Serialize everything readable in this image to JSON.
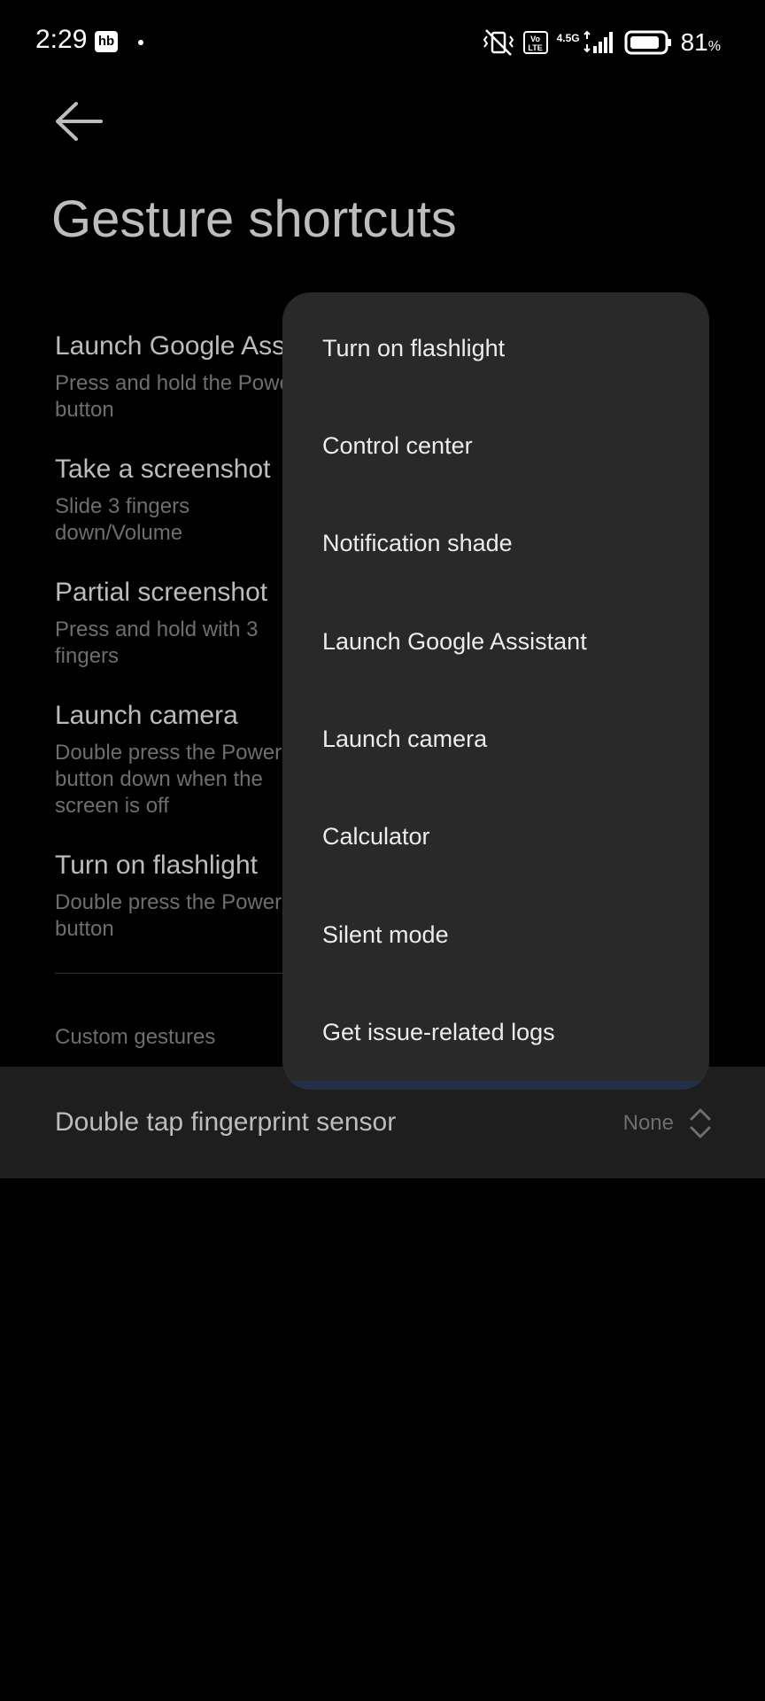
{
  "status_bar": {
    "time": "2:29",
    "badge": "hb",
    "network": "4.5G",
    "volte": "Vo LTE",
    "battery": "81",
    "battery_unit": "%"
  },
  "header": {
    "title": "Gesture shortcuts"
  },
  "settings": [
    {
      "title": "Launch Google Assistant",
      "desc": "Press and hold the Power button"
    },
    {
      "title": "Take a screenshot",
      "desc": "Slide 3 fingers down/Volume"
    },
    {
      "title": "Partial screenshot",
      "desc": "Press and hold with 3 fingers"
    },
    {
      "title": "Launch camera",
      "desc": "Double press the Power button down when the screen is off"
    },
    {
      "title": "Turn on flashlight",
      "desc": "Double press the Power button"
    }
  ],
  "section": {
    "custom_gestures": "Custom gestures"
  },
  "fingerprint": {
    "label": "Double tap fingerprint sensor",
    "value": "None"
  },
  "menu": {
    "items": [
      "Turn on flashlight",
      "Control center",
      "Notification shade",
      "Launch Google Assistant",
      "Launch camera",
      "Calculator",
      "Silent mode",
      "Get issue-related logs"
    ]
  },
  "colors": {
    "background": "#000000",
    "menu_bg": "#292929",
    "row_bg": "#1e1e1e"
  }
}
